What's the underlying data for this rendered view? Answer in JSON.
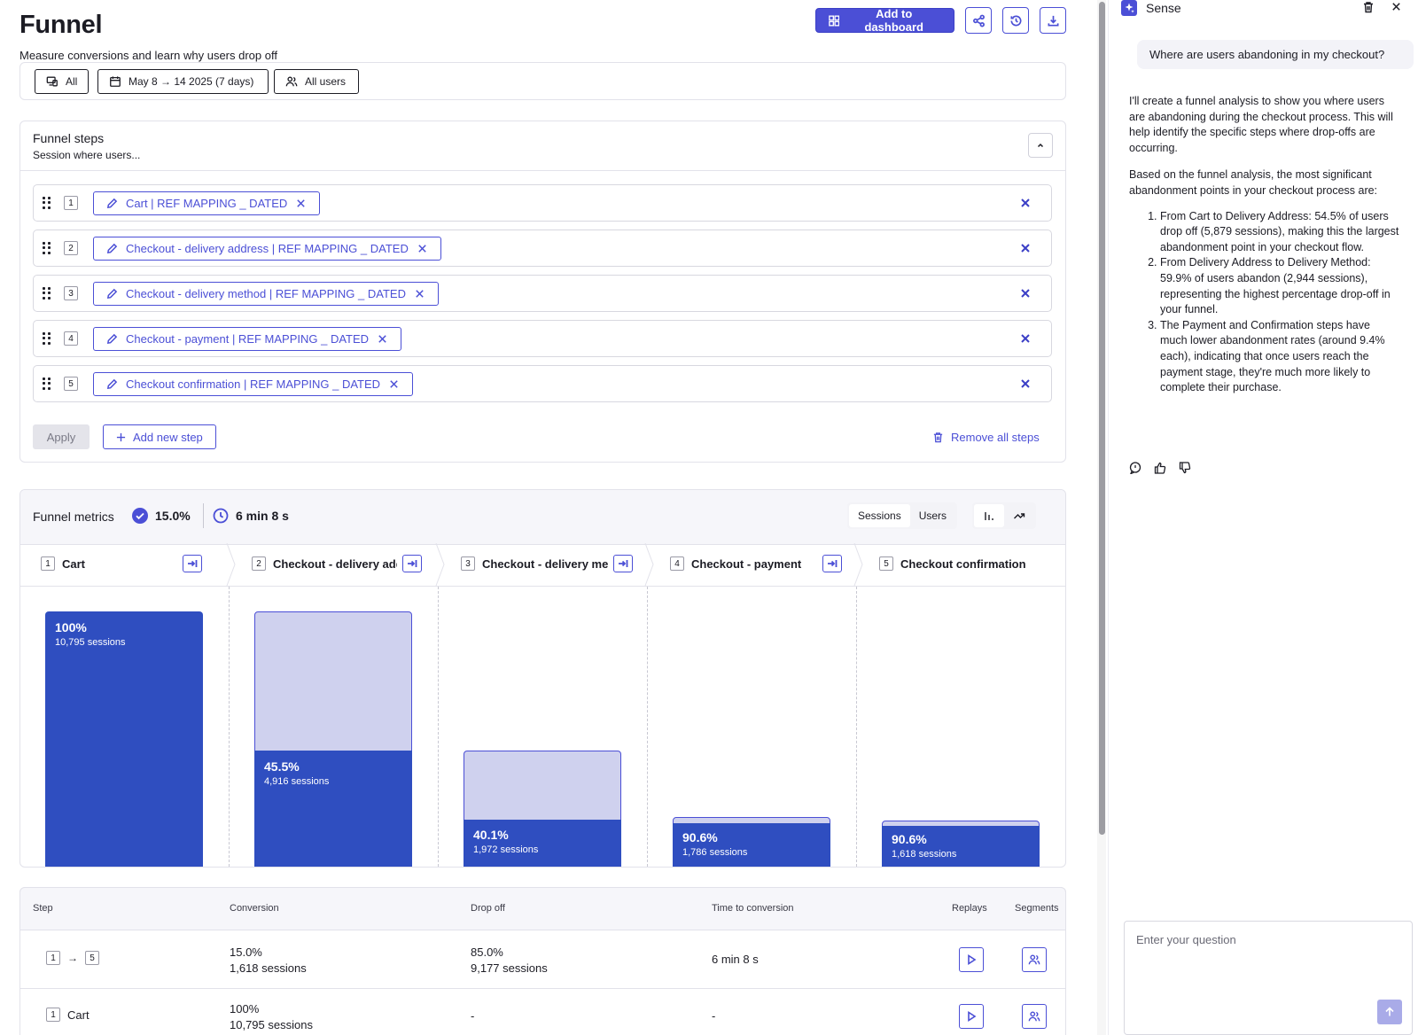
{
  "header": {
    "title": "Funnel",
    "subtitle": "Measure conversions and learn why users drop off",
    "add_to_dashboard": "Add to dashboard"
  },
  "filters": {
    "device": "All",
    "date_range": "May 8 → 14 2025 (7 days)",
    "audience": "All users"
  },
  "funnel_steps": {
    "title": "Funnel steps",
    "subtitle": "Session where users...",
    "steps": [
      {
        "number": "1",
        "label": "Cart | REF MAPPING _ DATED"
      },
      {
        "number": "2",
        "label": "Checkout - delivery address | REF MAPPING _ DATED"
      },
      {
        "number": "3",
        "label": "Checkout - delivery method | REF MAPPING _ DATED"
      },
      {
        "number": "4",
        "label": "Checkout - payment | REF MAPPING _ DATED"
      },
      {
        "number": "5",
        "label": "Checkout confirmation | REF MAPPING _ DATED"
      }
    ],
    "apply_label": "Apply",
    "add_step_label": "Add new step",
    "remove_all_label": "Remove all steps"
  },
  "metrics": {
    "title": "Funnel metrics",
    "conversion": "15.0%",
    "time": "6 min 8 s",
    "toggle_sessions": "Sessions",
    "toggle_users": "Users",
    "columns": [
      {
        "number": "1",
        "label": "Cart"
      },
      {
        "number": "2",
        "label": "Checkout - delivery address"
      },
      {
        "number": "3",
        "label": "Checkout - delivery method"
      },
      {
        "number": "4",
        "label": "Checkout - payment"
      },
      {
        "number": "5",
        "label": "Checkout confirmation"
      }
    ],
    "bars": [
      {
        "pct": "100%",
        "sessions": "10,795 sessions"
      },
      {
        "pct": "45.5%",
        "sessions": "4,916 sessions"
      },
      {
        "pct": "40.1%",
        "sessions": "1,972 sessions"
      },
      {
        "pct": "90.6%",
        "sessions": "1,786 sessions"
      },
      {
        "pct": "90.6%",
        "sessions": "1,618 sessions"
      }
    ]
  },
  "table": {
    "headers": {
      "step": "Step",
      "conversion": "Conversion",
      "dropoff": "Drop off",
      "time": "Time to conversion",
      "replays": "Replays",
      "segments": "Segments"
    },
    "rows": [
      {
        "from": "1",
        "arrow": "→",
        "to": "5",
        "conv_pct": "15.0%",
        "conv_sessions": "1,618 sessions",
        "drop_pct": "85.0%",
        "drop_sessions": "9,177 sessions",
        "time": "6 min 8 s"
      },
      {
        "num": "1",
        "name": "Cart",
        "conv_pct": "100%",
        "conv_sessions": "10,795 sessions",
        "drop": "-",
        "time": "-"
      }
    ]
  },
  "sidebar": {
    "title": "Sense",
    "user_question": "Where are users abandoning in my checkout?",
    "intro": "I'll create a funnel analysis to show you where users are abandoning during the checkout process. This will help identify the specific steps where drop-offs are occurring.",
    "lead": "Based on the funnel analysis, the most significant abandonment points in your checkout process are:",
    "points": [
      "From Cart to Delivery Address: 54.5% of users drop off (5,879 sessions), making this the largest abandonment point in your checkout flow.",
      "From Delivery Address to Delivery Method: 59.9% of users abandon (2,944 sessions), representing the highest percentage drop-off in your funnel.",
      "The Payment and Confirmation steps have much lower abandonment rates (around 9.4% each), indicating that once users reach the payment stage, they're much more likely to complete their purchase."
    ],
    "input_placeholder": "Enter your question"
  }
}
